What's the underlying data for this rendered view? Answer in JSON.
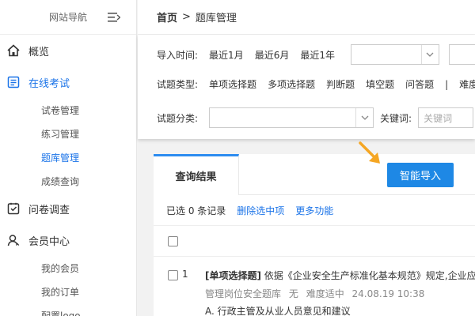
{
  "sidebar": {
    "title": "网站导航",
    "items": [
      {
        "label": "概览",
        "icon": "home-icon"
      },
      {
        "label": "在线考试",
        "icon": "exam-icon",
        "active": true,
        "children": [
          "试卷管理",
          "练习管理",
          "题库管理",
          "成绩查询"
        ]
      },
      {
        "label": "问卷调查",
        "icon": "survey-icon"
      },
      {
        "label": "会员中心",
        "icon": "user-icon",
        "children": [
          "我的会员",
          "我的订单",
          "配置logo"
        ]
      }
    ]
  },
  "breadcrumb": {
    "home": "首页",
    "sep": ">",
    "current": "题库管理"
  },
  "filters": {
    "import_time_label": "导入时间:",
    "import_time_options": [
      "最近1月",
      "最近6月",
      "最近1年"
    ],
    "type_label": "试题类型:",
    "type_options": [
      "单项选择题",
      "多项选择题",
      "判断题",
      "填空题",
      "问答题"
    ],
    "type_divider": "|",
    "type_extra": "难度",
    "category_label": "试题分类:",
    "keyword_label": "关键词:",
    "keyword_placeholder": "关键词"
  },
  "results": {
    "tab": "查询结果",
    "import_button": "智能导入",
    "selected_text": "已选 0 条记录",
    "delete_link": "删除选中项",
    "more_link": "更多功能",
    "rows": [
      {
        "num": "1",
        "type": "[单项选择题]",
        "text": " 依据《企业安全生产标准化基本规范》规定,企业应",
        "bank": "管理岗位安全题库",
        "category": "无",
        "difficulty": "难度适中",
        "date": "24.08.19 10:38",
        "option": "A. 行政主管及从业人员意见和建议"
      }
    ]
  },
  "colors": {
    "accent": "#1e88e5",
    "arrow": "#f5a623"
  }
}
